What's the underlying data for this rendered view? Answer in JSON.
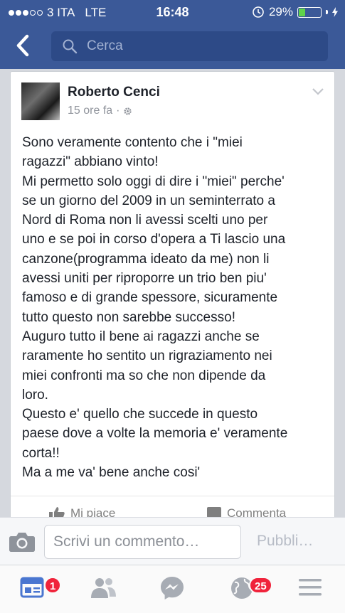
{
  "status_bar": {
    "carrier": "3 ITA",
    "network": "LTE",
    "time": "16:48",
    "battery_percent": "29%",
    "battery_level": 0.29
  },
  "search": {
    "placeholder": "Cerca"
  },
  "post": {
    "author": "Roberto Cenci",
    "time": "15 ore fa",
    "text": "Sono veramente contento che i \"miei\nragazzi\" abbiano vinto!\nMi permetto solo oggi di dire i \"miei\" perche'\nse un giorno del 2009 in un seminterrato a\nNord di Roma non li avessi scelti uno per\nuno e se poi in corso d'opera a Ti lascio una\ncanzone(programma ideato da me) non li\navessi uniti per riproporre un trio ben piu'\nfamoso e di grande spessore, sicuramente\ntutto questo non sarebbe successo!\nAuguro tutto il bene ai ragazzi anche se\nraramente ho sentito un rigraziamento nei\nmiei confronti ma so che non dipende da\nloro.\nQuesto e' quello che succede in questo\npaese dove a volte la memoria e' veramente\ncorta!!\nMa a me va' bene anche cosi'",
    "like_label": "Mi piace",
    "comment_label": "Commenta"
  },
  "comment_bar": {
    "placeholder": "Scrivi un commento…",
    "publish_label": "Pubbli…"
  },
  "tabbar": {
    "news_badge": "1",
    "notifications_badge": "25"
  },
  "colors": {
    "brand": "#3b5998",
    "badge": "#f0233b",
    "battery": "#5fd34b"
  },
  "icons": [
    "signal-icon",
    "alarm-icon",
    "battery-icon",
    "back-arrow-icon",
    "search-icon",
    "settings-icon",
    "chevron-down-icon",
    "like-icon",
    "comment-icon",
    "camera-icon",
    "news-feed-icon",
    "friends-icon",
    "messenger-icon",
    "globe-icon",
    "menu-icon"
  ]
}
